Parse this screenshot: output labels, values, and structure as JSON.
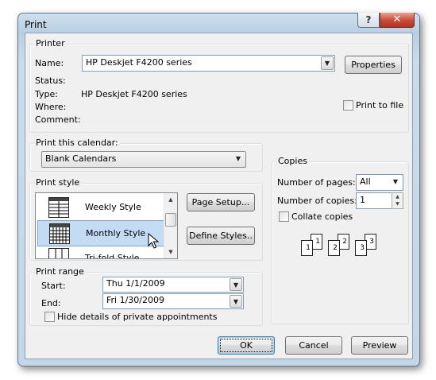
{
  "window": {
    "title": "Print",
    "help_label": "?",
    "close_label": "✕"
  },
  "printer": {
    "group_label": "Printer",
    "name_label": "Name:",
    "name_value": "HP Deskjet F4200 series",
    "properties_label": "Properties",
    "status_label": "Status:",
    "status_value": "",
    "type_label": "Type:",
    "type_value": "HP Deskjet F4200 series",
    "where_label": "Where:",
    "comment_label": "Comment:",
    "print_to_file_label": "Print to file",
    "print_to_file_checked": false
  },
  "calendar": {
    "group_label": "Print this calendar:",
    "value": "Blank Calendars"
  },
  "print_style": {
    "group_label": "Print style",
    "items": [
      {
        "label": "Weekly Style",
        "selected": false
      },
      {
        "label": "Monthly Style",
        "selected": true
      },
      {
        "label": "Tri-fold Style",
        "selected": false
      }
    ],
    "page_setup_label": "Page Setup...",
    "define_styles_label": "Define Styles.."
  },
  "copies": {
    "group_label": "Copies",
    "pages_label": "Number of pages:",
    "pages_value": "All",
    "copies_label": "Number of copies:",
    "copies_value": "1",
    "collate_label": "Collate copies",
    "collate_checked": false,
    "collate_pages": [
      "1",
      "2",
      "3"
    ]
  },
  "print_range": {
    "group_label": "Print range",
    "start_label": "Start:",
    "start_value": "Thu 1/1/2009",
    "end_label": "End:",
    "end_value": "Fri 1/30/2009",
    "hide_private_label": "Hide details of private appointments",
    "hide_private_checked": false
  },
  "buttons": {
    "ok": "OK",
    "cancel": "Cancel",
    "preview": "Preview"
  },
  "colors": {
    "selection": "#c4dcf3",
    "frame": "#b8cfe2",
    "close": "#c94a35",
    "face": "#f0f0f0"
  }
}
